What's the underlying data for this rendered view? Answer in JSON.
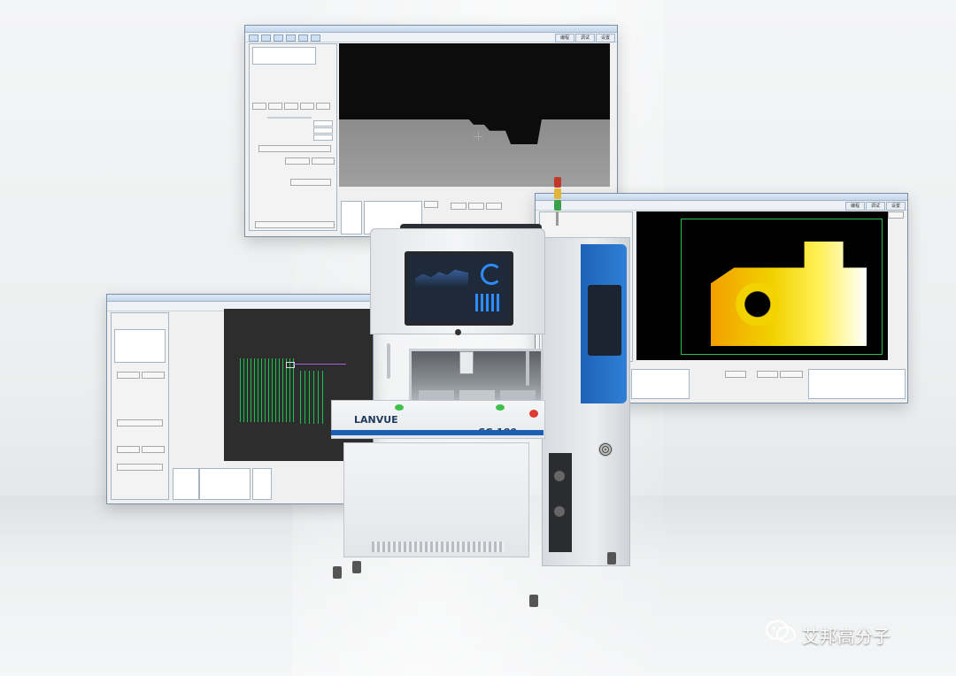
{
  "watermark": {
    "icon": "wechat-icon",
    "text": "艾邦高分子"
  },
  "machine": {
    "logo": "LANVUE",
    "model": "SC-180"
  },
  "colors": {
    "accent_blue": "#1a5fb4",
    "ui_frame": "#7a8ea8",
    "thermal_yellow": "#f2d200",
    "trace_green": "#19c24a"
  },
  "windows": {
    "top": {
      "tabs": [
        "编程",
        "调试",
        "设置"
      ]
    },
    "right": {
      "tabs": [
        "编程",
        "调试",
        "设置"
      ]
    },
    "left": {
      "tabs": []
    }
  }
}
